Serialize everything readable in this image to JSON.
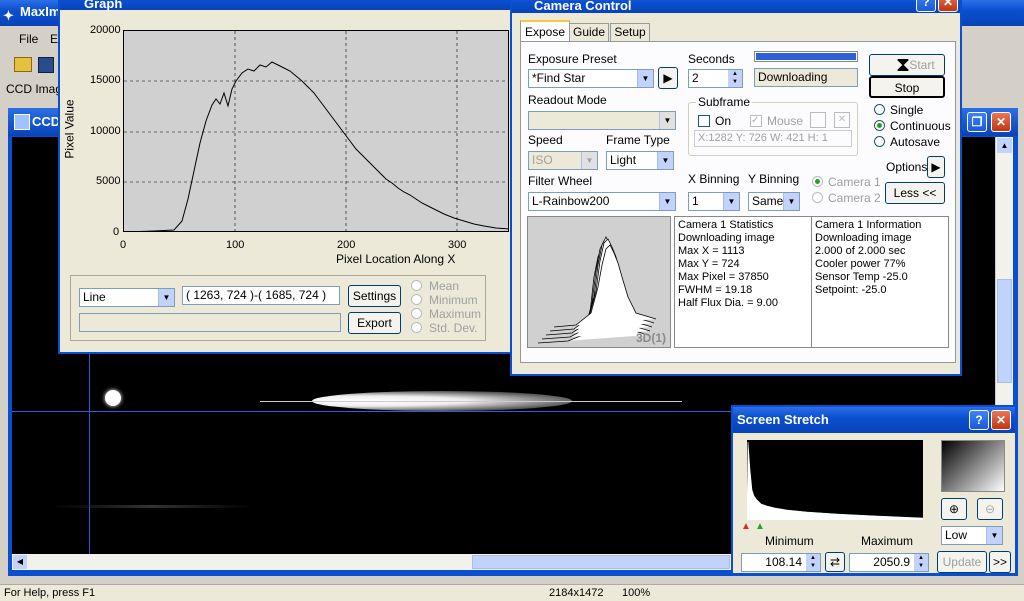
{
  "main": {
    "title": "MaxIm",
    "menu": [
      "File",
      "E"
    ],
    "tab_label": "CCD Imag",
    "child_title": "CCD"
  },
  "graph": {
    "title": "Graph",
    "yticks": [
      "20000",
      "15000",
      "10000",
      "5000",
      "0"
    ],
    "xticks": [
      "0",
      "100",
      "200",
      "300"
    ],
    "xlabel": "Pixel Location Along X",
    "ylabel": "Pixel Value",
    "mode": "Line",
    "coords": "( 1263, 724 )-( 1685, 724 )",
    "settings_btn": "Settings",
    "export_btn": "Export",
    "radio_options": [
      "Mean",
      "Minimum",
      "Maximum",
      "Std. Dev."
    ]
  },
  "camera": {
    "title": "Camera Control",
    "tabs": [
      "Expose",
      "Guide",
      "Setup"
    ],
    "exposure_preset_label": "Exposure Preset",
    "exposure_preset": "*Find Star",
    "seconds_label": "Seconds",
    "seconds": "2",
    "status": "Downloading",
    "progress": 1.0,
    "start_btn": "Start",
    "stop_btn": "Stop",
    "readout_label": "Readout Mode",
    "subframe_label": "Subframe",
    "on_label": "On",
    "mouse_label": "Mouse",
    "subframe_coords": "X:1282 Y: 726 W: 421 H:  1",
    "mode_options": [
      "Single",
      "Continuous",
      "Autosave"
    ],
    "mode_selected": "Continuous",
    "options_btn": "Options",
    "less_btn": "Less <<",
    "speed_label": "Speed",
    "speed": "ISO",
    "frame_type_label": "Frame Type",
    "frame_type": "Light",
    "filter_label": "Filter Wheel",
    "filter": "L-Rainbow200",
    "xbin_label": "X Binning",
    "xbin": "1",
    "ybin_label": "Y Binning",
    "ybin": "Same",
    "camera_options": [
      "Camera 1",
      "Camera 2"
    ],
    "plot_label": "3D(1)",
    "stats": [
      "Camera 1 Statistics",
      "Downloading image",
      "Max X = 1113",
      "Max Y = 724",
      "Max Pixel = 37850",
      "FWHM = 19.18",
      "Half Flux Dia. = 9.00"
    ],
    "info": [
      "Camera 1 Information",
      "Downloading image",
      "2.000 of 2.000 sec",
      "Cooler power 77%",
      "Sensor Temp -25.0",
      "Setpoint: -25.0"
    ]
  },
  "stretch": {
    "title": "Screen Stretch",
    "min_label": "Minimum",
    "max_label": "Maximum",
    "min_value": "108.14",
    "max_value": "2050.9",
    "preset": "Low",
    "update_btn": "Update",
    "more_btn": ">>"
  },
  "status_bar": {
    "help": "For Help, press F1",
    "dims": "2184x1472",
    "zoom": "100%"
  },
  "colors": {
    "xp_blue": "#0a4fd0",
    "progress": "#2f5fd8"
  }
}
